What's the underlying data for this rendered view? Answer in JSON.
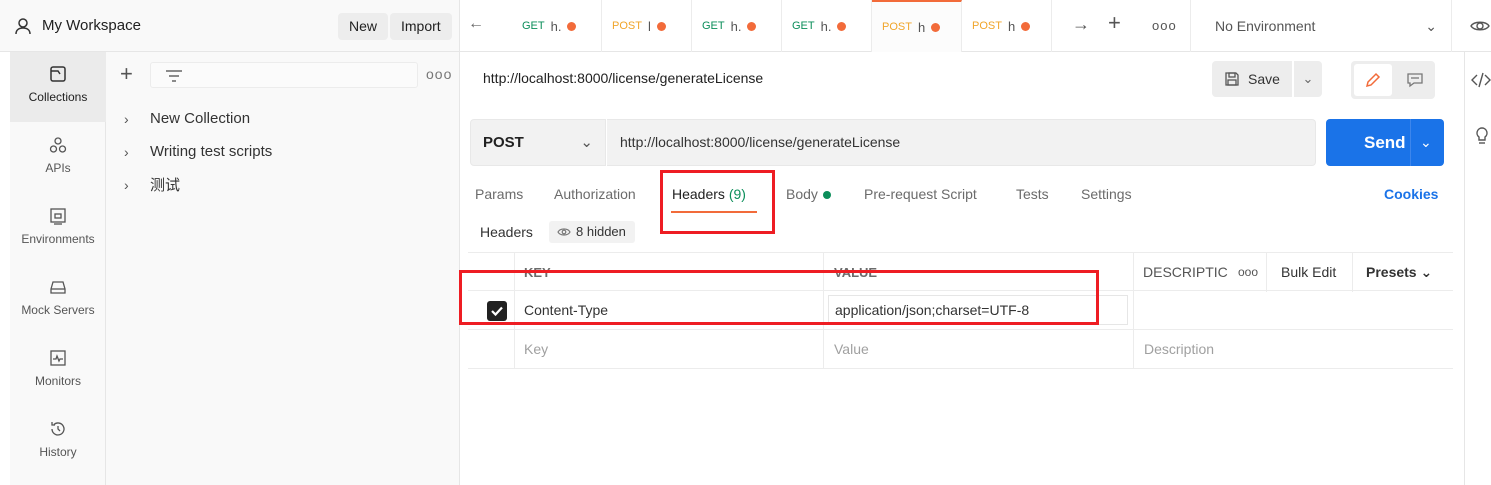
{
  "workspace": {
    "title": "My Workspace",
    "new_label": "New",
    "import_label": "Import"
  },
  "rail": {
    "items": [
      {
        "label": "Collections",
        "icon": "collections-icon",
        "active": true
      },
      {
        "label": "APIs",
        "icon": "apis-icon"
      },
      {
        "label": "Environments",
        "icon": "environments-icon"
      },
      {
        "label": "Mock Servers",
        "icon": "mock-servers-icon"
      },
      {
        "label": "Monitors",
        "icon": "monitors-icon"
      },
      {
        "label": "History",
        "icon": "history-icon"
      }
    ]
  },
  "collections": {
    "more_label": "ooo",
    "items": [
      {
        "label": "New Collection"
      },
      {
        "label": "Writing test scripts"
      },
      {
        "label": "测试"
      }
    ]
  },
  "tabs": {
    "items": [
      {
        "method": "GET",
        "name": "h.",
        "modified": true
      },
      {
        "method": "POST",
        "name": "l",
        "modified": true
      },
      {
        "method": "GET",
        "name": "h.",
        "modified": true
      },
      {
        "method": "GET",
        "name": "h.",
        "modified": true
      },
      {
        "method": "POST",
        "name": "h",
        "modified": true,
        "active": true
      },
      {
        "method": "POST",
        "name": "h",
        "modified": true
      }
    ],
    "more_label": "ooo",
    "environment": "No Environment"
  },
  "request": {
    "title": "http://localhost:8000/license/generateLicense",
    "save_label": "Save",
    "method": "POST",
    "url": "http://localhost:8000/license/generateLicense",
    "send_label": "Send",
    "subtabs": {
      "params": "Params",
      "authorization": "Authorization",
      "headers": "Headers",
      "headers_count": "(9)",
      "body": "Body",
      "prerequest": "Pre-request Script",
      "tests": "Tests",
      "settings": "Settings"
    },
    "cookies_label": "Cookies"
  },
  "headers_panel": {
    "label": "Headers",
    "hidden_label": "8 hidden",
    "columns": {
      "key": "KEY",
      "value": "VALUE",
      "description": "DESCRIPTIC",
      "more": "ooo",
      "bulk_edit": "Bulk Edit",
      "presets": "Presets"
    },
    "rows": [
      {
        "checked": true,
        "key": "Content-Type",
        "value": "application/json;charset=UTF-8",
        "description": ""
      }
    ],
    "placeholders": {
      "key": "Key",
      "value": "Value",
      "description": "Description"
    }
  },
  "colors": {
    "accent": "#f26b3a",
    "send": "#1a73e8",
    "get": "#0b8e5a",
    "post": "#f0a52a",
    "annotation": "#ee1d23"
  }
}
